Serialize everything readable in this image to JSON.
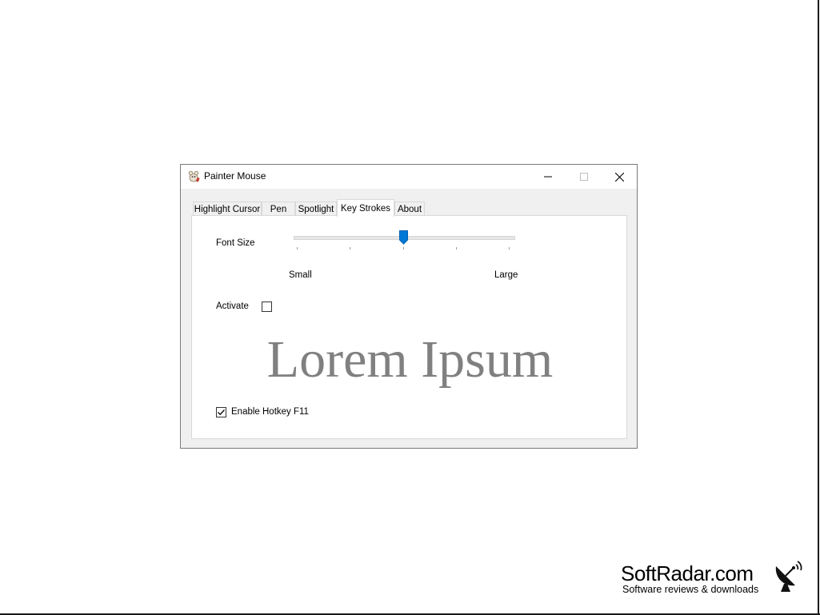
{
  "window": {
    "title": "Painter Mouse",
    "controls": [
      "minimize-icon",
      "maximize-icon",
      "close-icon"
    ]
  },
  "tabs": [
    {
      "label": "Highlight Cursor",
      "active": false
    },
    {
      "label": "Pen",
      "active": false
    },
    {
      "label": "Spotlight",
      "active": false
    },
    {
      "label": "Key Strokes",
      "active": true
    },
    {
      "label": "About",
      "active": false
    }
  ],
  "key_strokes": {
    "font_size_label": "Font Size",
    "slider": {
      "min_label": "Small",
      "max_label": "Large",
      "value_fraction": 0.5,
      "tick_count": 5
    },
    "activate_label": "Activate",
    "activate_checked": false,
    "preview_text": "Lorem Ipsum",
    "hotkey_label": "Enable Hotkey F11",
    "hotkey_checked": true
  },
  "colors": {
    "accent": "#0078d7",
    "preview_text": "#808080"
  },
  "watermark": {
    "brand": "SoftRadar.com",
    "tagline": "Software reviews & downloads"
  }
}
